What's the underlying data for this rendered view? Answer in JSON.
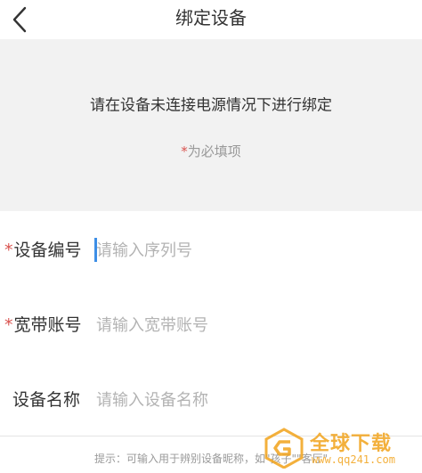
{
  "header": {
    "title": "绑定设备"
  },
  "notice": {
    "message": "请在设备未连接电源情况下进行绑定",
    "required_star": "*",
    "required_text": "为必填项"
  },
  "form": {
    "rows": [
      {
        "required": "*",
        "label": "设备编号",
        "placeholder": "请输入序列号"
      },
      {
        "required": "*",
        "label": "宽带账号",
        "placeholder": "请输入宽带账号"
      },
      {
        "required": "",
        "label": "设备名称",
        "placeholder": "请输入设备名称"
      }
    ]
  },
  "hint": "提示：可输入用于辨别设备昵称，如\"孩子\"\"客厅\"",
  "watermark": {
    "brand_text": "全球下载",
    "url": "www.qq241.com"
  },
  "colors": {
    "required_star": "#d9534f",
    "cursor": "#3d8ee6",
    "notice_bg": "#f2f2f2",
    "watermark": "#f2a31b"
  },
  "icons": {
    "back": "chevron-left-icon",
    "watermark_logo": "g-logo-icon"
  }
}
